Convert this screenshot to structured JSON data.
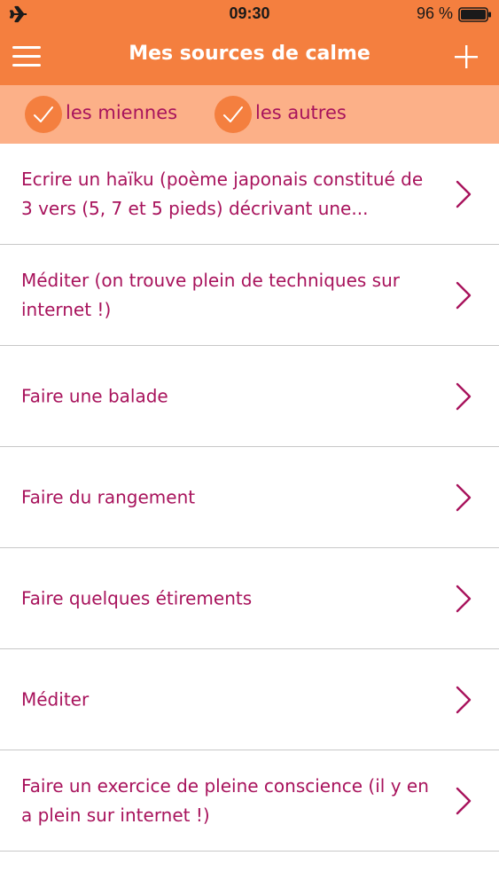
{
  "status_bar": {
    "time": "09:30",
    "battery": "96 %",
    "airplane_icon": "airplane-icon",
    "battery_icon": "battery-icon"
  },
  "nav": {
    "title": "Mes sources de calme",
    "menu_icon": "hamburger-menu-icon",
    "add_icon": "plus-icon"
  },
  "filters": [
    {
      "label": "les miennes",
      "checked": true
    },
    {
      "label": "les autres",
      "checked": true
    }
  ],
  "items": [
    {
      "text": "Ecrire un haïku (poème japonais constitué de 3 vers (5, 7 et 5 pieds) décrivant une..."
    },
    {
      "text": "Méditer (on trouve plein de techniques sur internet !)"
    },
    {
      "text": "Faire une balade"
    },
    {
      "text": "Faire du rangement"
    },
    {
      "text": "Faire quelques étirements"
    },
    {
      "text": "Méditer"
    },
    {
      "text": "Faire un exercice de pleine conscience (il y en a plein sur internet !)"
    }
  ],
  "colors": {
    "header": "#f47f3f",
    "filter_bar": "#fcb088",
    "accent_text": "#a8135c",
    "divider": "#c8c8c8"
  }
}
